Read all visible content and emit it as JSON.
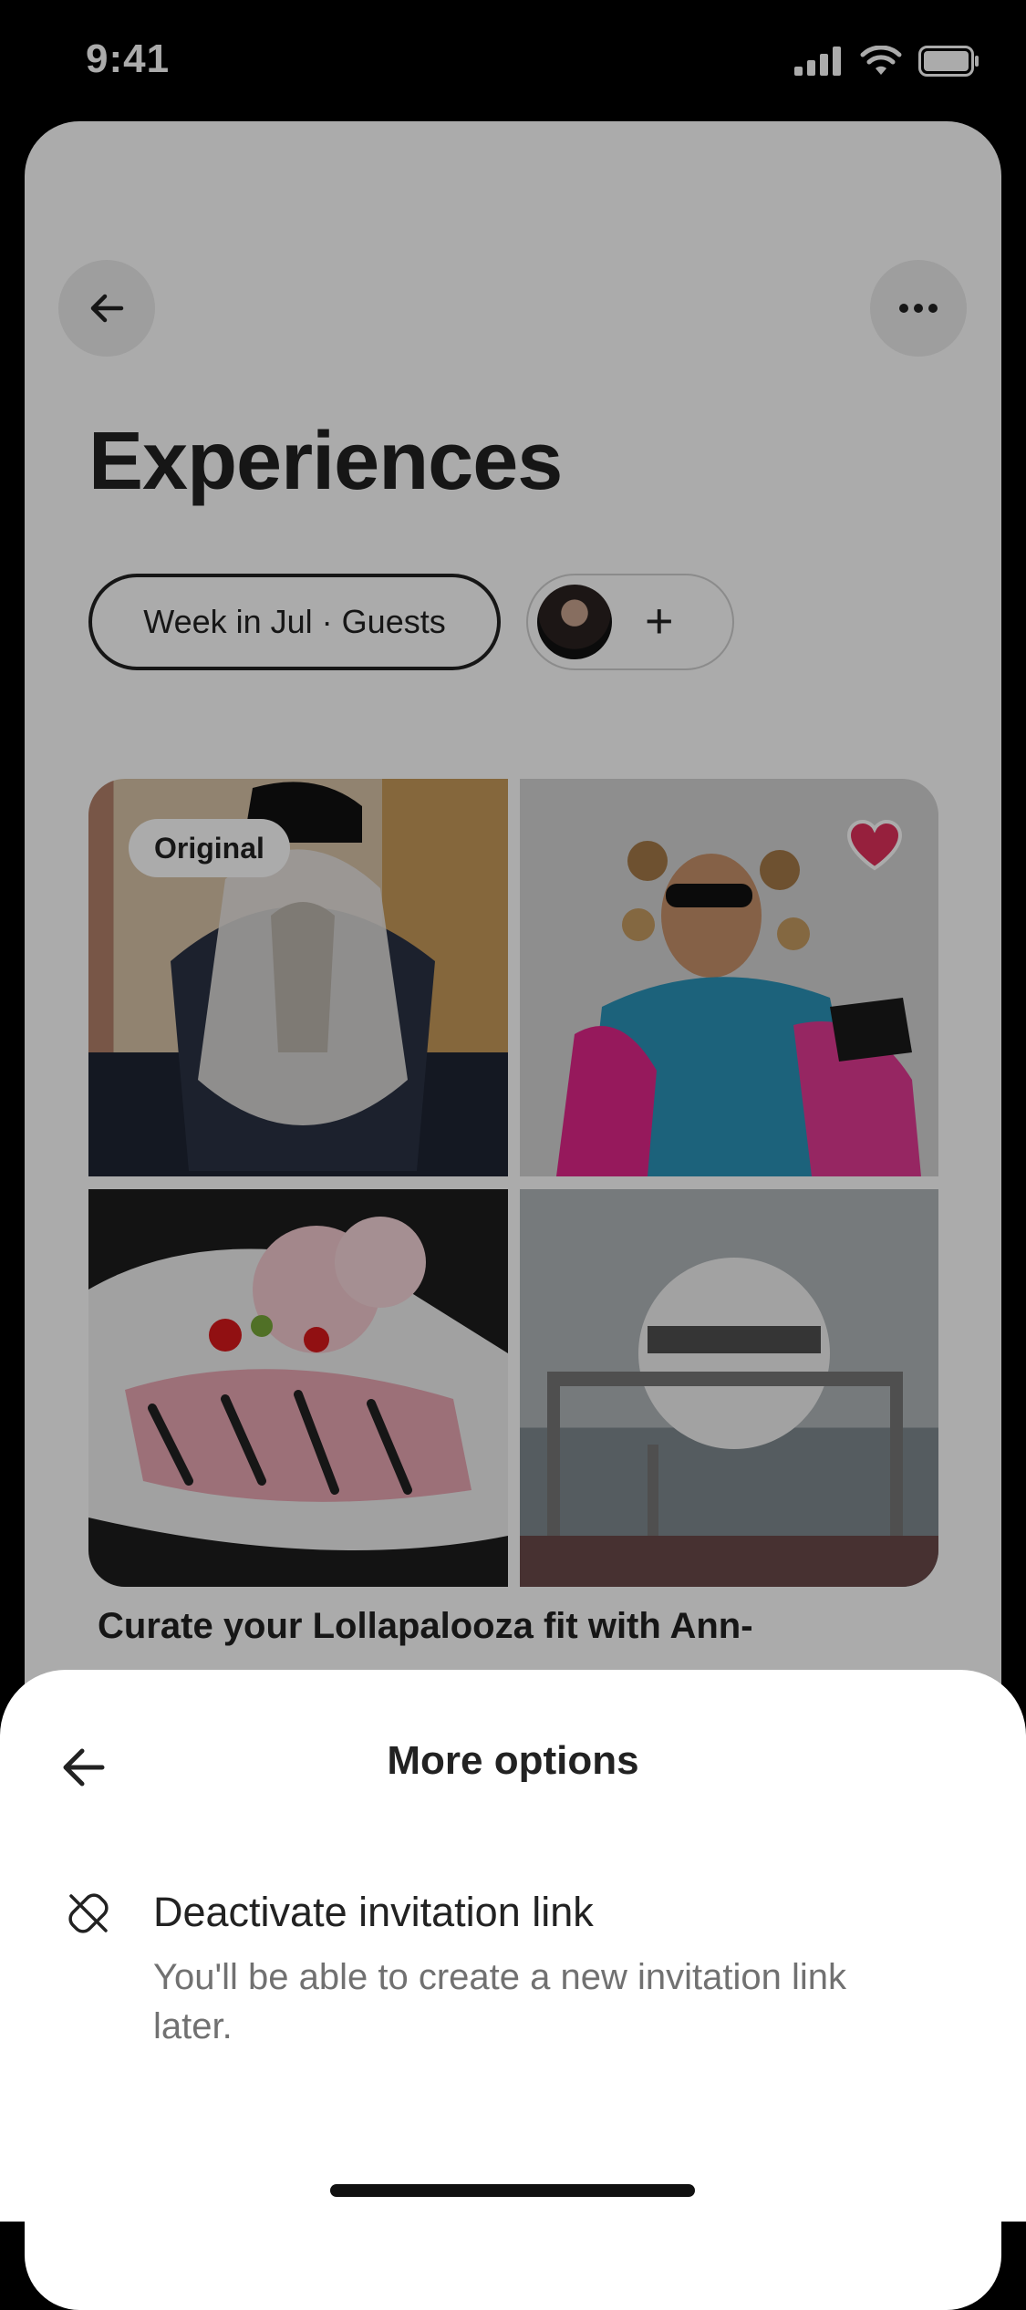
{
  "status_bar": {
    "time": "9:41"
  },
  "page": {
    "title": "Experiences",
    "filter_pill": "Week in Jul · Guests",
    "add_guest_symbol": "+",
    "badge": "Original",
    "experience_title": "Curate your Lollapalooza fit with Ann-"
  },
  "sheet": {
    "title": "More options",
    "option": {
      "title": "Deactivate invitation link",
      "description": "You'll be able to create a new invitation link later."
    }
  },
  "colors": {
    "heart": "#e0305b",
    "text_primary": "#222222",
    "text_secondary": "#717171"
  },
  "icons": [
    "back-arrow-icon",
    "more-dots-icon",
    "heart-icon",
    "unlink-icon",
    "plus-icon"
  ]
}
